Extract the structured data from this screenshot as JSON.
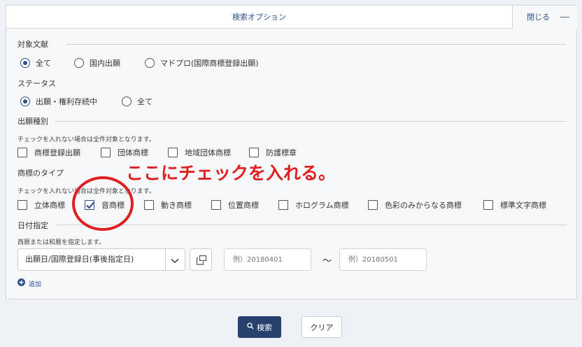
{
  "header": {
    "title": "検索オプション",
    "close_label": "閉じる"
  },
  "target_doc": {
    "title": "対象文献",
    "options": [
      {
        "label": "全て",
        "selected": true
      },
      {
        "label": "国内出願",
        "selected": false
      },
      {
        "label": "マドプロ(国際商標登録出願)",
        "selected": false
      }
    ]
  },
  "status": {
    "title": "ステータス",
    "options": [
      {
        "label": "出願・権利存続中",
        "selected": true
      },
      {
        "label": "全て",
        "selected": false
      }
    ]
  },
  "application_type": {
    "title": "出願種別",
    "hint": "チェックを入れない場合は全件対象となります。",
    "options": [
      {
        "label": "商標登録出願",
        "checked": false
      },
      {
        "label": "団体商標",
        "checked": false
      },
      {
        "label": "地域団体商標",
        "checked": false
      },
      {
        "label": "防護標章",
        "checked": false
      }
    ]
  },
  "mark_type": {
    "title": "商標のタイプ",
    "hint": "チェックを入れない場合は全件対象となります。",
    "options": [
      {
        "label": "立体商標",
        "checked": false
      },
      {
        "label": "音商標",
        "checked": true
      },
      {
        "label": "動き商標",
        "checked": false
      },
      {
        "label": "位置商標",
        "checked": false
      },
      {
        "label": "ホログラム商標",
        "checked": false
      },
      {
        "label": "色彩のみからなる商標",
        "checked": false
      },
      {
        "label": "標準文字商標",
        "checked": false
      }
    ]
  },
  "date": {
    "title": "日付指定",
    "hint": "西暦または和暦を指定します。",
    "select_value": "出願日/国際登録日(事後指定日)",
    "from_placeholder": "例）20180401",
    "separator": "〜",
    "to_placeholder": "例）20180501",
    "add_label": "追加"
  },
  "actions": {
    "search_label": "検索",
    "clear_label": "クリア"
  },
  "annotation": {
    "text": "ここにチェックを入れる。"
  },
  "colors": {
    "accent": "#26416b",
    "link": "#30508a",
    "annotation": "#e02020"
  }
}
